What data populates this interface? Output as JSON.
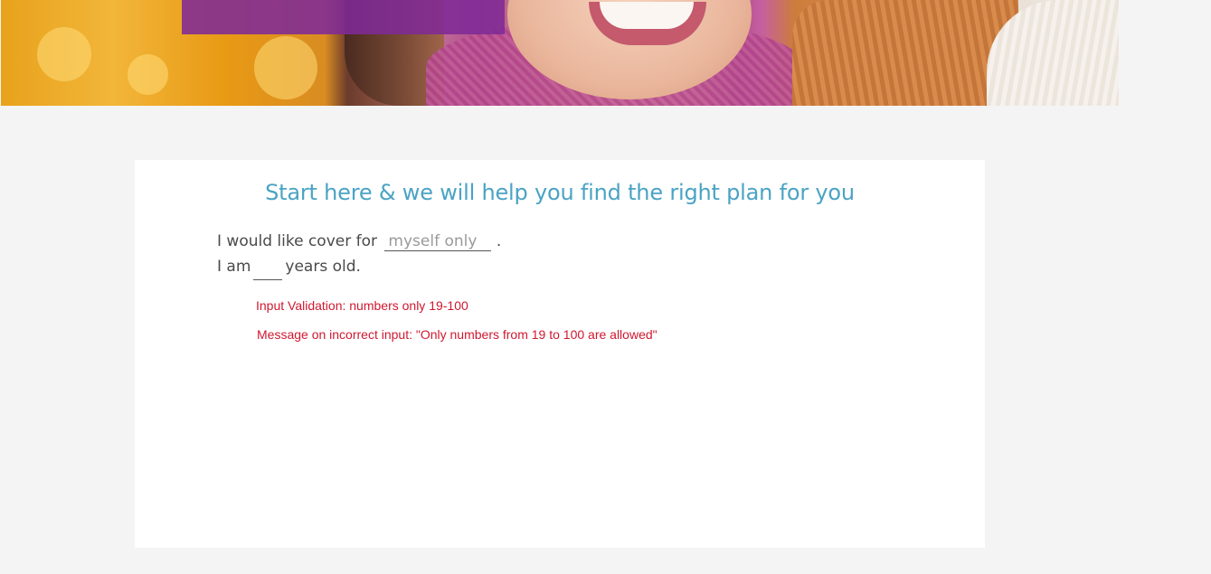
{
  "hero": {
    "image": "hero-photo-smiling-woman-scarf",
    "promo_bar_color": "#802a96"
  },
  "form": {
    "heading": "Start here & we will help you find the right plan for you",
    "cover_prefix": "I would like cover for",
    "cover_value": "myself only",
    "cover_suffix": ".",
    "age_prefix": "I am",
    "age_value": "",
    "age_suffix": "years old."
  },
  "annotations": {
    "validation_note": "Input Validation: numbers only 19-100",
    "error_message_note": "Message on incorrect input: \"Only numbers from 19 to 100 are allowed\""
  },
  "colors": {
    "heading": "#4aa3c4",
    "annotation": "#d0182f",
    "background": "#f4f4f4"
  }
}
